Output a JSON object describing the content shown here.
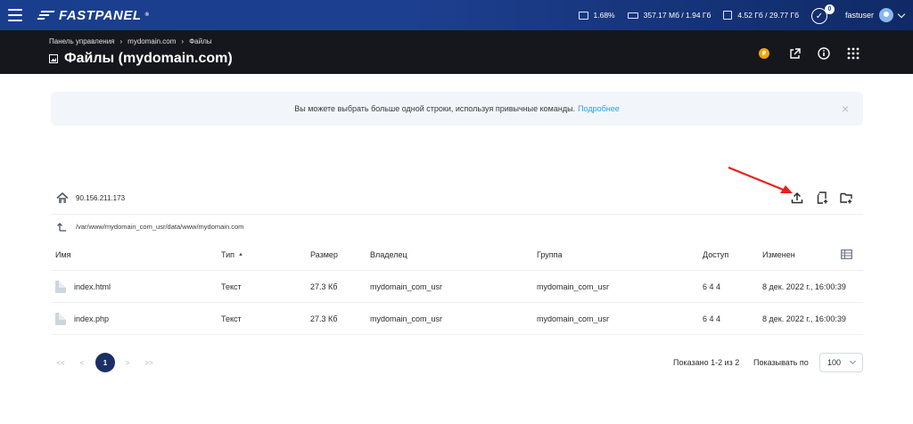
{
  "topbar": {
    "logo_text": "FASTPANEL",
    "logo_mark": "®",
    "cpu": "1.68%",
    "ram": "357.17 Мб / 1.94 Гб",
    "disk": "4.52 Гб / 29.77 Гб",
    "notifications_count": "0",
    "username": "fastuser"
  },
  "header": {
    "breadcrumbs": [
      "Панель управления",
      "mydomain.com",
      "Файлы"
    ],
    "crumb_separator": "›",
    "title": "Файлы (mydomain.com)",
    "coin_glyph": "₽"
  },
  "notice": {
    "text": "Вы можете выбрать больше одной строки, используя привычные команды.",
    "link": "Подробнее",
    "close": "×"
  },
  "toolbar": {
    "server_ip": "90.156.211.173"
  },
  "path": "/var/www/mydomain_com_usr/data/www/mydomain.com",
  "table": {
    "columns": {
      "name": "Имя",
      "type": "Тип",
      "size": "Размер",
      "owner": "Владелец",
      "group": "Группа",
      "access": "Доступ",
      "modified": "Изменен"
    },
    "sort_indicator": "▲",
    "rows": [
      {
        "name": "index.html",
        "type": "Текст",
        "size": "27.3 Кб",
        "owner": "mydomain_com_usr",
        "group": "mydomain_com_usr",
        "access": "6 4 4",
        "modified": "8 дек. 2022 г., 16:00:39"
      },
      {
        "name": "index.php",
        "type": "Текст",
        "size": "27.3 Кб",
        "owner": "mydomain_com_usr",
        "group": "mydomain_com_usr",
        "access": "6 4 4",
        "modified": "8 дек. 2022 г., 16:00:39"
      }
    ]
  },
  "pagination": {
    "first": "<<",
    "prev": "<",
    "current": "1",
    "next": ">",
    "last": ">>",
    "info": "Показано 1-2 из 2",
    "per_page_label": "Показывать по",
    "per_page_value": "100"
  },
  "colors": {
    "topbar": "#1d3f8f",
    "header": "#16171c",
    "accent_link": "#2aa0e6",
    "active_page": "#1b2f66",
    "annotation_arrow": "#e8201c"
  }
}
